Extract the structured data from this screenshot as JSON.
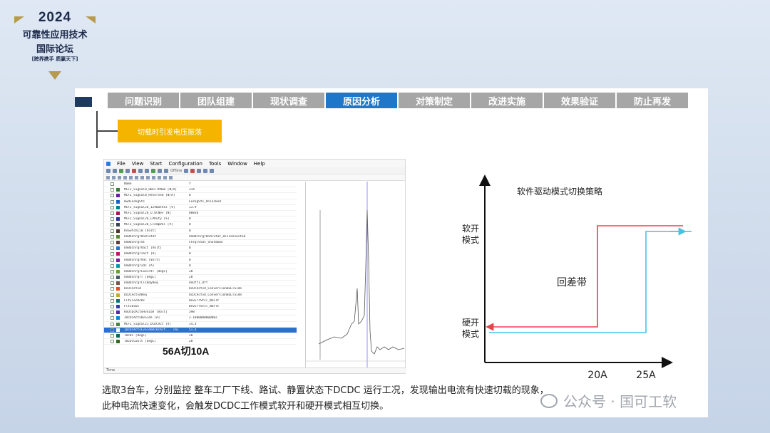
{
  "logo": {
    "year": "2024",
    "line1": "可靠性应用技术",
    "line2": "国际论坛",
    "line3": "[跨界携手 质赢天下]"
  },
  "nav": {
    "tabs": [
      {
        "label": "问题识别",
        "active": false
      },
      {
        "label": "团队组建",
        "active": false
      },
      {
        "label": "现状调查",
        "active": false
      },
      {
        "label": "原因分析",
        "active": true
      },
      {
        "label": "对策制定",
        "active": false
      },
      {
        "label": "改进实施",
        "active": false
      },
      {
        "label": "效果验证",
        "active": false
      },
      {
        "label": "防止再发",
        "active": false
      }
    ]
  },
  "tag_label": "切载时引发电压振荡",
  "window": {
    "menu": [
      "File",
      "View",
      "Start",
      "Configuration",
      "Tools",
      "Window",
      "Help"
    ],
    "toolbar_text": [
      "Offline"
    ],
    "caption": "56A切10A",
    "footer": "Time",
    "signals": [
      {
        "name": "Name",
        "value": "Y",
        "color": "#ffffff"
      },
      {
        "name": "MCF2_Signal8_OBCFltNum [N/A]",
        "value": "214",
        "color": "#2e7d32"
      },
      {
        "name": "MCF2_Signal8_Reserved [N/A]",
        "value": "0",
        "color": "#6a1b9a"
      },
      {
        "name": "HwdLockgSts",
        "value": "LockgSts_Unlocked",
        "color": "#1565c0"
      },
      {
        "name": "MCF2_Signal26_12VBatVal [V]",
        "value": "13.9",
        "color": "#00838f"
      },
      {
        "name": "MCF2_Signal26_O_OCNev [N]",
        "value": "88836",
        "color": "#ad1457"
      },
      {
        "name": "MCF2_Signal26_CPDuty [%]",
        "value": "0",
        "color": "#283593"
      },
      {
        "name": "MCF2_Signal26_CTempVal [V]",
        "value": "0",
        "color": "#37474f"
      },
      {
        "name": "HvSwtchLim [Volt]",
        "value": "0",
        "color": "#4e342e"
      },
      {
        "name": "OnBdChrgrHndlStat",
        "value": "OnBdChrgrHndlStat_Disconnected",
        "color": "#558b2f"
      },
      {
        "name": "OnBdChrgrSt",
        "value": "ChrgrStat_Shutdown",
        "color": "#5d4037"
      },
      {
        "name": "OnBdChrgrVact [Volt]",
        "value": "0",
        "color": "#1976d2"
      },
      {
        "name": "OnBdChrgrIact [A]",
        "value": "0",
        "color": "#c2185b"
      },
      {
        "name": "OnBdChrgrVdc [Volt]",
        "value": "0",
        "color": "#7b1fa2"
      },
      {
        "name": "OnBdChrgrIdc [A]",
        "value": "0",
        "color": "#0097a7"
      },
      {
        "name": "OnBdChrgrCoolntT [degC]",
        "value": "28",
        "color": "#689f38"
      },
      {
        "name": "OnBdChrgrT [degC]",
        "value": "28",
        "color": "#455a64"
      },
      {
        "name": "OnBdChrgrClsRdyReq",
        "value": "OnOff1_Off",
        "color": "#795548"
      },
      {
        "name": "DcDcActvd",
        "value": "DcDcActvd_ConversionBuLTSide",
        "color": "#e64a19"
      },
      {
        "name": "DcDcActvdReq",
        "value": "DcDcActvd_ConversionBuLTSide",
        "color": "#afb42b"
      },
      {
        "name": "FltElecDcDc",
        "value": "DevErrStsl_NoFlt",
        "color": "#00796b"
      },
      {
        "name": "FltIDcDc",
        "value": "DevErrStsl_NoFlt",
        "color": "#303f9f"
      },
      {
        "name": "HvDcDcActvHvSide [Volt]",
        "value": "398",
        "color": "#512da8"
      },
      {
        "name": "IDcDcActvHvSide [A]",
        "value": "2.1000000000002",
        "color": "#0288d1"
      },
      {
        "name": "MCF2_Signal21_DCDCAct [V]",
        "value": "14.4",
        "color": "#388e3c"
      },
      {
        "name": "IDcDcActvLvSideDcDcAct... [A]",
        "value": "51.4",
        "color": "#ffffff",
        "selected": true
      },
      {
        "name": "TDcDc [degC]",
        "value": "28",
        "color": "#00695c"
      },
      {
        "name": "TDcDcCoolt [degC]",
        "value": "28",
        "color": "#33691e"
      }
    ]
  },
  "strategy_chart": {
    "title": "软件驱动模式切换策略",
    "y_top_label_1": "软开",
    "y_top_label_2": "模式",
    "y_bottom_label_1": "硬开",
    "y_bottom_label_2": "模式",
    "band_label": "回差带",
    "x_ticks": [
      "20A",
      "25A"
    ],
    "colors": {
      "red": "#e8424a",
      "cyan": "#45c4e0",
      "axis": "#111111"
    }
  },
  "bottom_text": {
    "line1": "选取3台车，分别监控 整车工厂下线、路试、静置状态下DCDC 运行工况，发现输出电流有快速切载的现象，",
    "line2": "此种电流快速变化，会触发DCDC工作模式软开和硬开模式相互切换。"
  },
  "watermark": "公众号 · 国可工软",
  "chart_data": {
    "type": "line",
    "title": "软件驱动模式切换策略",
    "xlabel": "",
    "ylabel": "",
    "x_ticks": [
      "20A",
      "25A"
    ],
    "series": [
      {
        "x": [
          "0",
          "20A",
          "20A",
          "end"
        ],
        "y": [
          "硬开模式",
          "硬开模式",
          "软开模式",
          "软开模式"
        ],
        "color": "#e8424a"
      },
      {
        "x": [
          "end",
          "25A",
          "25A",
          "0"
        ],
        "y": [
          "软开模式",
          "软开模式",
          "硬开模式",
          "硬开模式"
        ],
        "color": "#45c4e0"
      }
    ],
    "annotations": [
      "回差带"
    ],
    "grid": false
  }
}
